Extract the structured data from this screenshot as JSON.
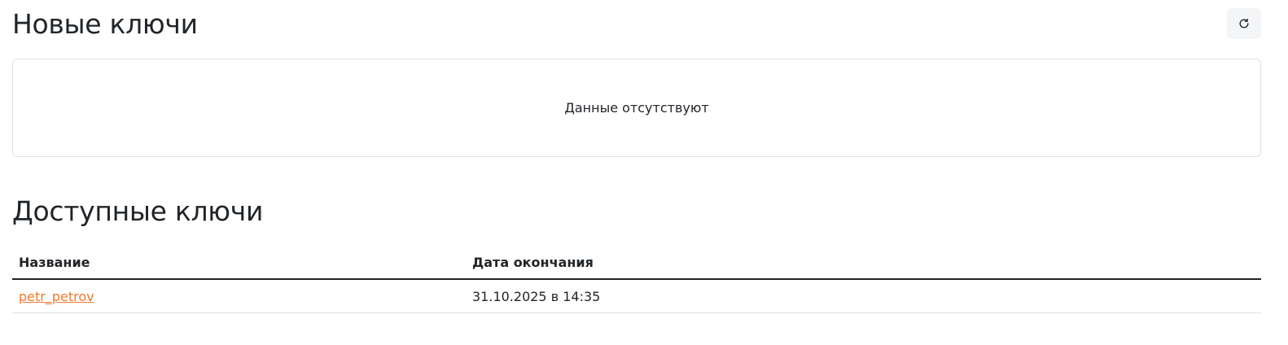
{
  "new_keys": {
    "title": "Новые ключи",
    "empty_message": "Данные отсутствуют"
  },
  "available_keys": {
    "title": "Доступные ключи",
    "columns": [
      "Название",
      "Дата окончания"
    ],
    "rows": [
      {
        "name": "petr_petrov",
        "expires": "31.10.2025 в 14:35"
      }
    ]
  },
  "icons": {
    "refresh": "refresh-icon"
  },
  "colors": {
    "link": "#f07a2c",
    "text": "#212529",
    "border": "#dee2e6",
    "button_bg": "#f4f5f6"
  }
}
